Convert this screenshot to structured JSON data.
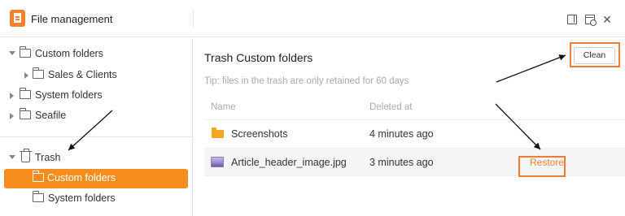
{
  "window": {
    "title": "File management"
  },
  "sidebar": {
    "items": [
      {
        "label": "Custom folders"
      },
      {
        "label": "Sales & Clients"
      },
      {
        "label": "System folders"
      },
      {
        "label": "Seafile"
      },
      {
        "label": "Trash"
      },
      {
        "label": "Custom folders"
      },
      {
        "label": "System folders"
      }
    ]
  },
  "main": {
    "title": "Trash Custom folders",
    "clean_label": "Clean",
    "tip": "Tip: files in the trash are only retained for 60 days",
    "columns": {
      "name": "Name",
      "deleted": "Deleted at"
    },
    "rows": [
      {
        "name": "Screenshots",
        "deleted": "4 minutes ago",
        "icon": "folder-icon"
      },
      {
        "name": "Article_header_image.jpg",
        "deleted": "3 minutes ago",
        "icon": "image-icon",
        "action": "Restore"
      }
    ]
  },
  "colors": {
    "accent": "#f7812d",
    "annotation": "#ee7d31",
    "arrow": "#111111"
  },
  "icons": [
    "app-logo-icon",
    "panel-toggle-icon",
    "trash-history-icon",
    "close-icon",
    "folder-icon",
    "trash-icon",
    "image-icon"
  ]
}
